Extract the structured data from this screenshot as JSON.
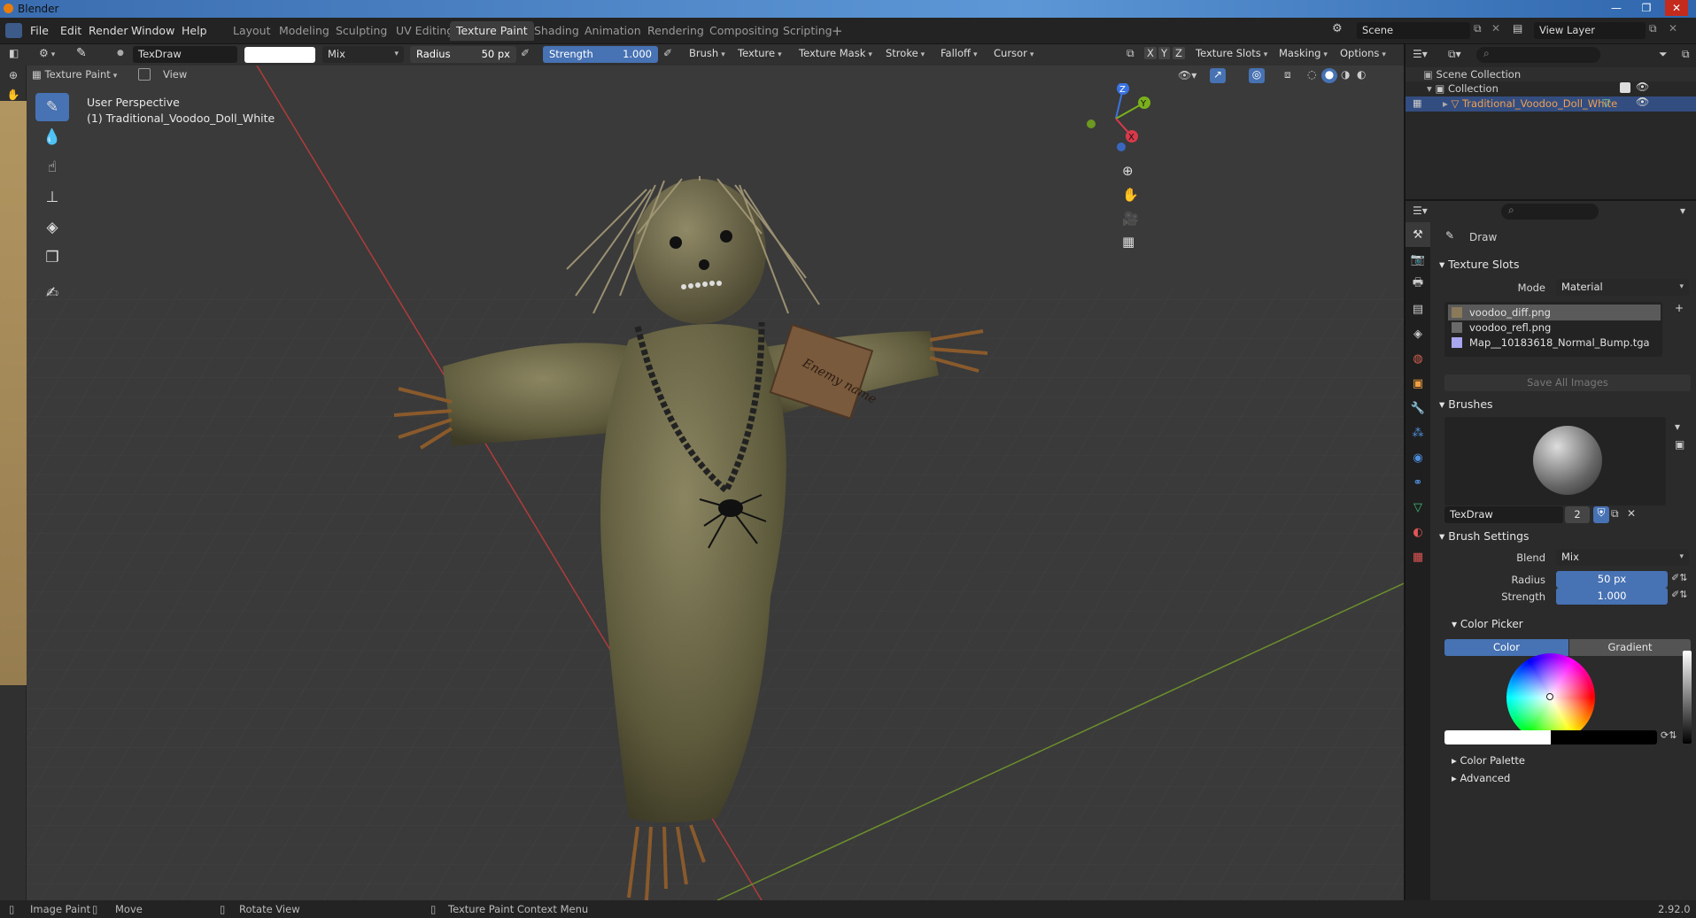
{
  "window": {
    "title": "Blender",
    "buttons": [
      "—",
      "❐",
      "✕"
    ]
  },
  "menu": {
    "items": [
      "File",
      "Edit",
      "Render",
      "Window",
      "Help"
    ]
  },
  "workspaces": {
    "tabs": [
      "Layout",
      "Modeling",
      "Sculpting",
      "UV Editing",
      "Texture Paint",
      "Shading",
      "Animation",
      "Rendering",
      "Compositing",
      "Scripting"
    ],
    "active": "Texture Paint",
    "add_label": "+"
  },
  "scene": {
    "scene_name": "Scene",
    "view_layer": "View Layer"
  },
  "tool_header": {
    "brush_name": "TexDraw",
    "blend": "Mix",
    "radius_label": "Radius",
    "radius_value": "50 px",
    "strength_label": "Strength",
    "strength_value": "1.000",
    "menus": [
      "Brush",
      "Texture",
      "Texture Mask",
      "Stroke",
      "Falloff",
      "Cursor"
    ],
    "axes": [
      "X",
      "Y",
      "Z"
    ],
    "right_menus": [
      "Texture Slots",
      "Masking",
      "Options"
    ]
  },
  "header2": {
    "mode": "Texture Paint",
    "view": "View"
  },
  "viewport": {
    "perspective": "User Perspective",
    "object_label": "(1) Traditional_Voodoo_Doll_White",
    "tag_text": "Enemy name",
    "gizmo_axes": [
      "Z",
      "Y",
      "X"
    ]
  },
  "outliner": {
    "root": "Scene Collection",
    "collection": "Collection",
    "object": "Traditional_Voodoo_Doll_White"
  },
  "properties": {
    "tool_name": "Draw",
    "texture_slots": {
      "title": "Texture Slots",
      "mode_label": "Mode",
      "mode_value": "Material",
      "images": [
        "voodoo_diff.png",
        "voodoo_refl.png",
        "Map__10183618_Normal_Bump.tga"
      ],
      "selected_index": 0,
      "save_all": "Save All Images"
    },
    "brushes": {
      "title": "Brushes",
      "brush_name": "TexDraw",
      "users": "2"
    },
    "brush_settings": {
      "title": "Brush Settings",
      "blend_label": "Blend",
      "blend_value": "Mix",
      "radius_label": "Radius",
      "radius_value": "50 px",
      "strength_label": "Strength",
      "strength_value": "1.000"
    },
    "color_picker": {
      "title": "Color Picker",
      "tab_color": "Color",
      "tab_gradient": "Gradient"
    },
    "color_palette": "Color Palette",
    "advanced": "Advanced"
  },
  "statusbar": {
    "items": [
      "Image Paint",
      "Move",
      "Rotate View",
      "Texture Paint Context Menu"
    ],
    "version": "2.92.0"
  }
}
